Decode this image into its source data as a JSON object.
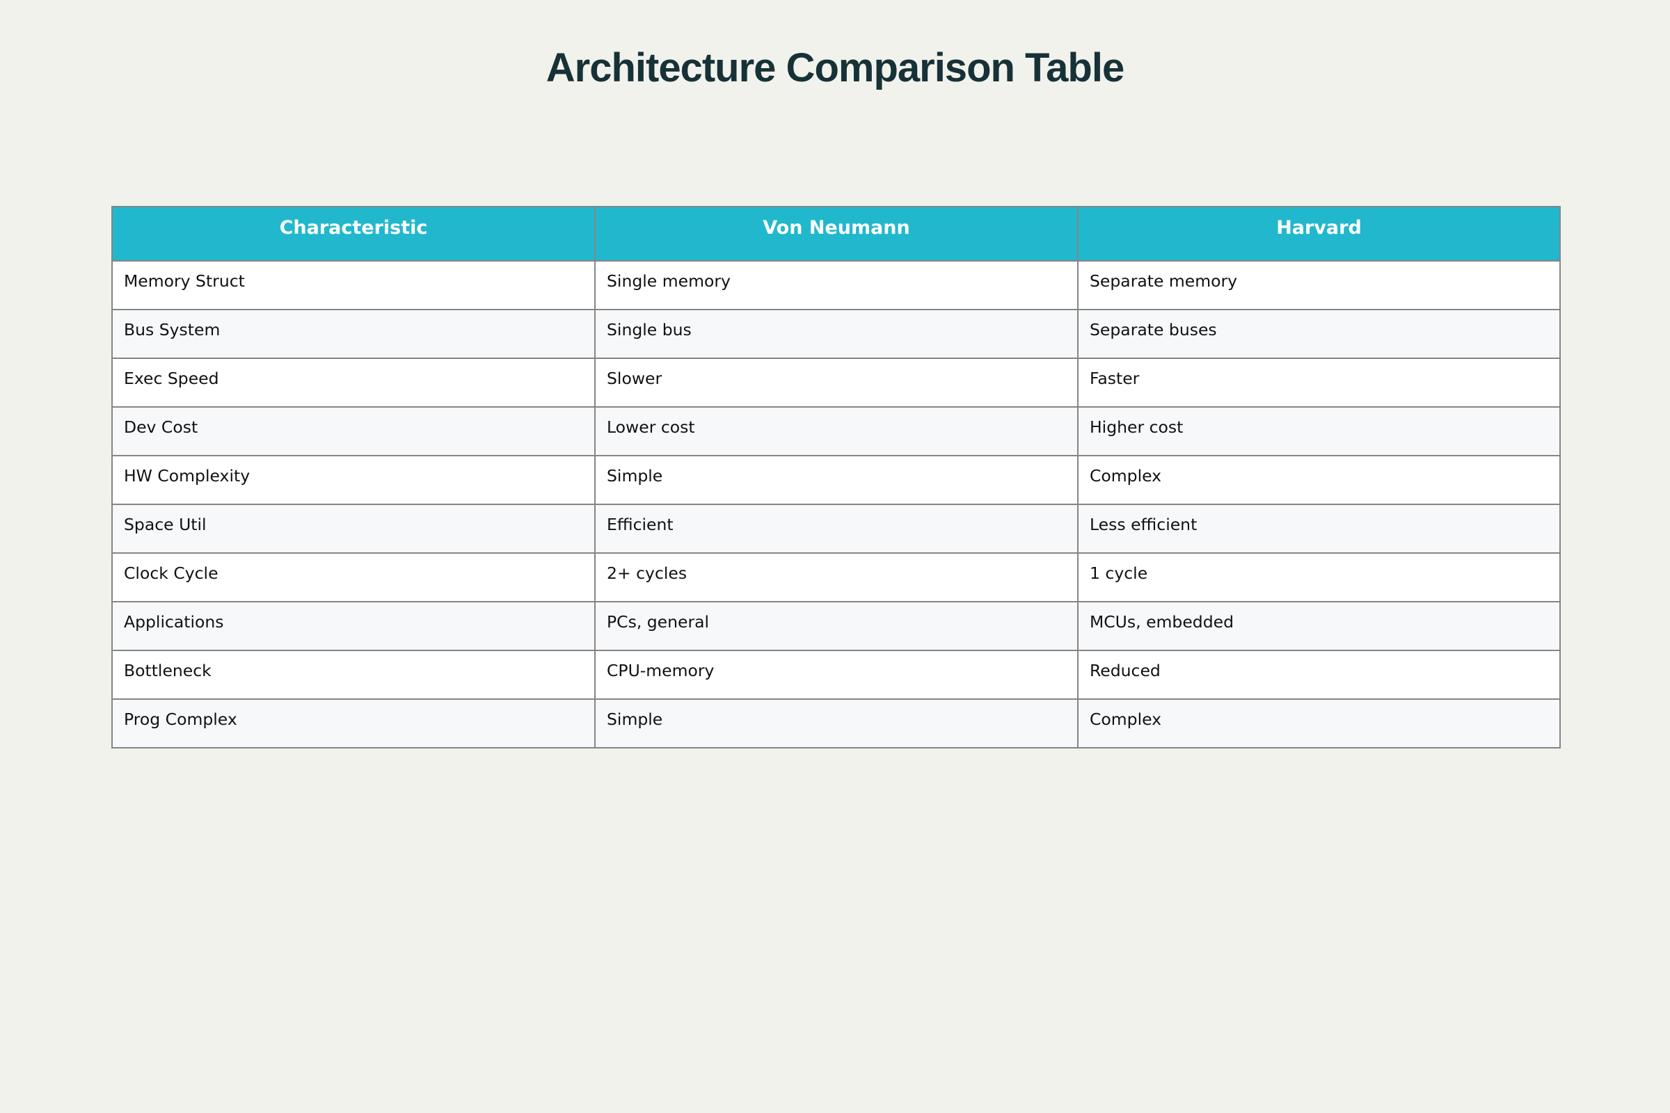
{
  "page": {
    "title": "Architecture Comparison Table"
  },
  "chart_data": {
    "type": "table",
    "title": "Architecture Comparison Table",
    "columns": [
      "Characteristic",
      "Von Neumann",
      "Harvard"
    ],
    "rows": [
      [
        "Memory Struct",
        "Single memory",
        "Separate memory"
      ],
      [
        "Bus System",
        "Single bus",
        "Separate buses"
      ],
      [
        "Exec Speed",
        "Slower",
        "Faster"
      ],
      [
        "Dev Cost",
        "Lower cost",
        "Higher cost"
      ],
      [
        "HW Complexity",
        "Simple",
        "Complex"
      ],
      [
        "Space Util",
        "Efficient",
        "Less efficient"
      ],
      [
        "Clock Cycle",
        "2+ cycles",
        "1 cycle"
      ],
      [
        "Applications",
        "PCs, general",
        "MCUs, embedded"
      ],
      [
        "Bottleneck",
        "CPU-memory",
        "Reduced"
      ],
      [
        "Prog Complex",
        "Simple",
        "Complex"
      ]
    ]
  },
  "colors": {
    "background": "#f2f2ed",
    "header_fill": "#21b8cd",
    "header_text": "#ffffff",
    "title_text": "#173237",
    "border": "#858585",
    "row_odd": "#ffffff",
    "row_even": "#f7f8fa"
  }
}
